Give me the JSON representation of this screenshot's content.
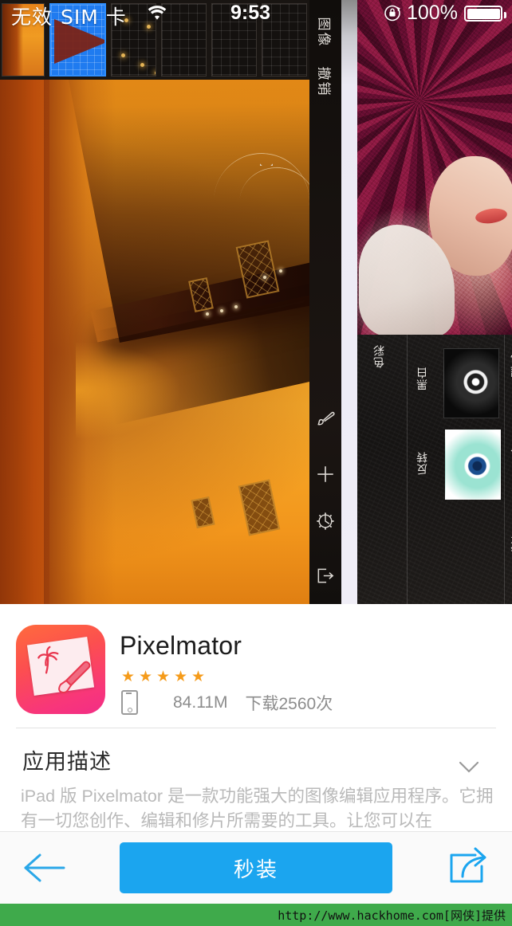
{
  "status_bar": {
    "carrier": "无效",
    "sim": "SIM 卡",
    "wifi_icon": "wifi-icon",
    "time": "9:53",
    "rotation_lock_icon": "rotation-lock-icon",
    "battery_percent": "100%",
    "battery_icon": "battery-full-icon"
  },
  "gallery": {
    "left_screenshot": {
      "name": "pixelmator-editor-screenshot",
      "rail_labels": [
        "图像",
        "撤销"
      ],
      "rail_icons": [
        "paint-brush-icon",
        "plus-icon",
        "gear-icon",
        "export-icon"
      ]
    },
    "right_screenshot": {
      "name": "pixelmator-effects-screenshot",
      "group_label": "色彩",
      "effects": [
        "黑白",
        "反转"
      ],
      "edge_labels": [
        "褪色",
        "冷",
        "胶片"
      ]
    }
  },
  "app": {
    "icon_name": "pixelmator-app-icon",
    "title": "Pixelmator",
    "rating": 5,
    "rating_star_color": "#f59b1a",
    "device_icon": "iphone-icon",
    "size": "84.11M",
    "downloads": "下载2560次"
  },
  "description": {
    "heading": "应用描述",
    "expand_icon": "chevron-down-icon",
    "body": "iPad 版 Pixelmator 是一款功能强大的图像编辑应用程序。它拥有一切您创作、编辑和修片所需要的工具。让您可以在"
  },
  "bottom_bar": {
    "back_icon": "back-arrow-icon",
    "install_label": "秒装",
    "install_color": "#1ba5ef",
    "share_icon": "share-icon"
  },
  "footer": {
    "text": "http://www.hackhome.com[网侠]提供",
    "background": "#3faa4b"
  }
}
